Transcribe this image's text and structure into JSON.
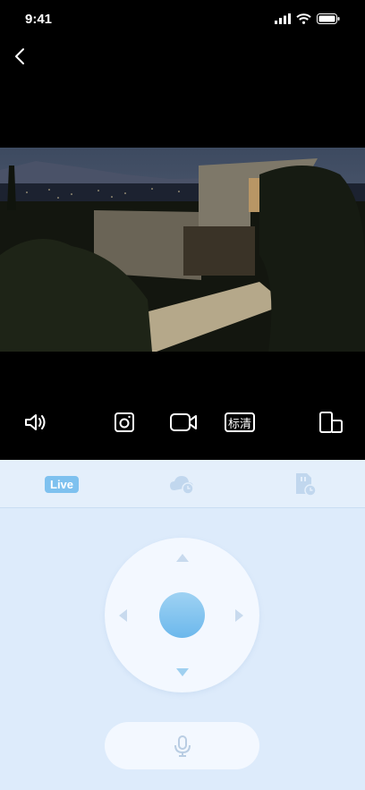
{
  "status_bar": {
    "time": "9:41"
  },
  "controls": {
    "quality_label": "标清"
  },
  "tabs": [
    {
      "label": "Live",
      "active": true
    },
    {
      "name": "cloud-playback"
    },
    {
      "name": "sd-card-playback"
    }
  ],
  "colors": {
    "accent": "#7ec1ef",
    "panel_bg": "#ddebfb",
    "arrow": "#9fd0f0"
  }
}
